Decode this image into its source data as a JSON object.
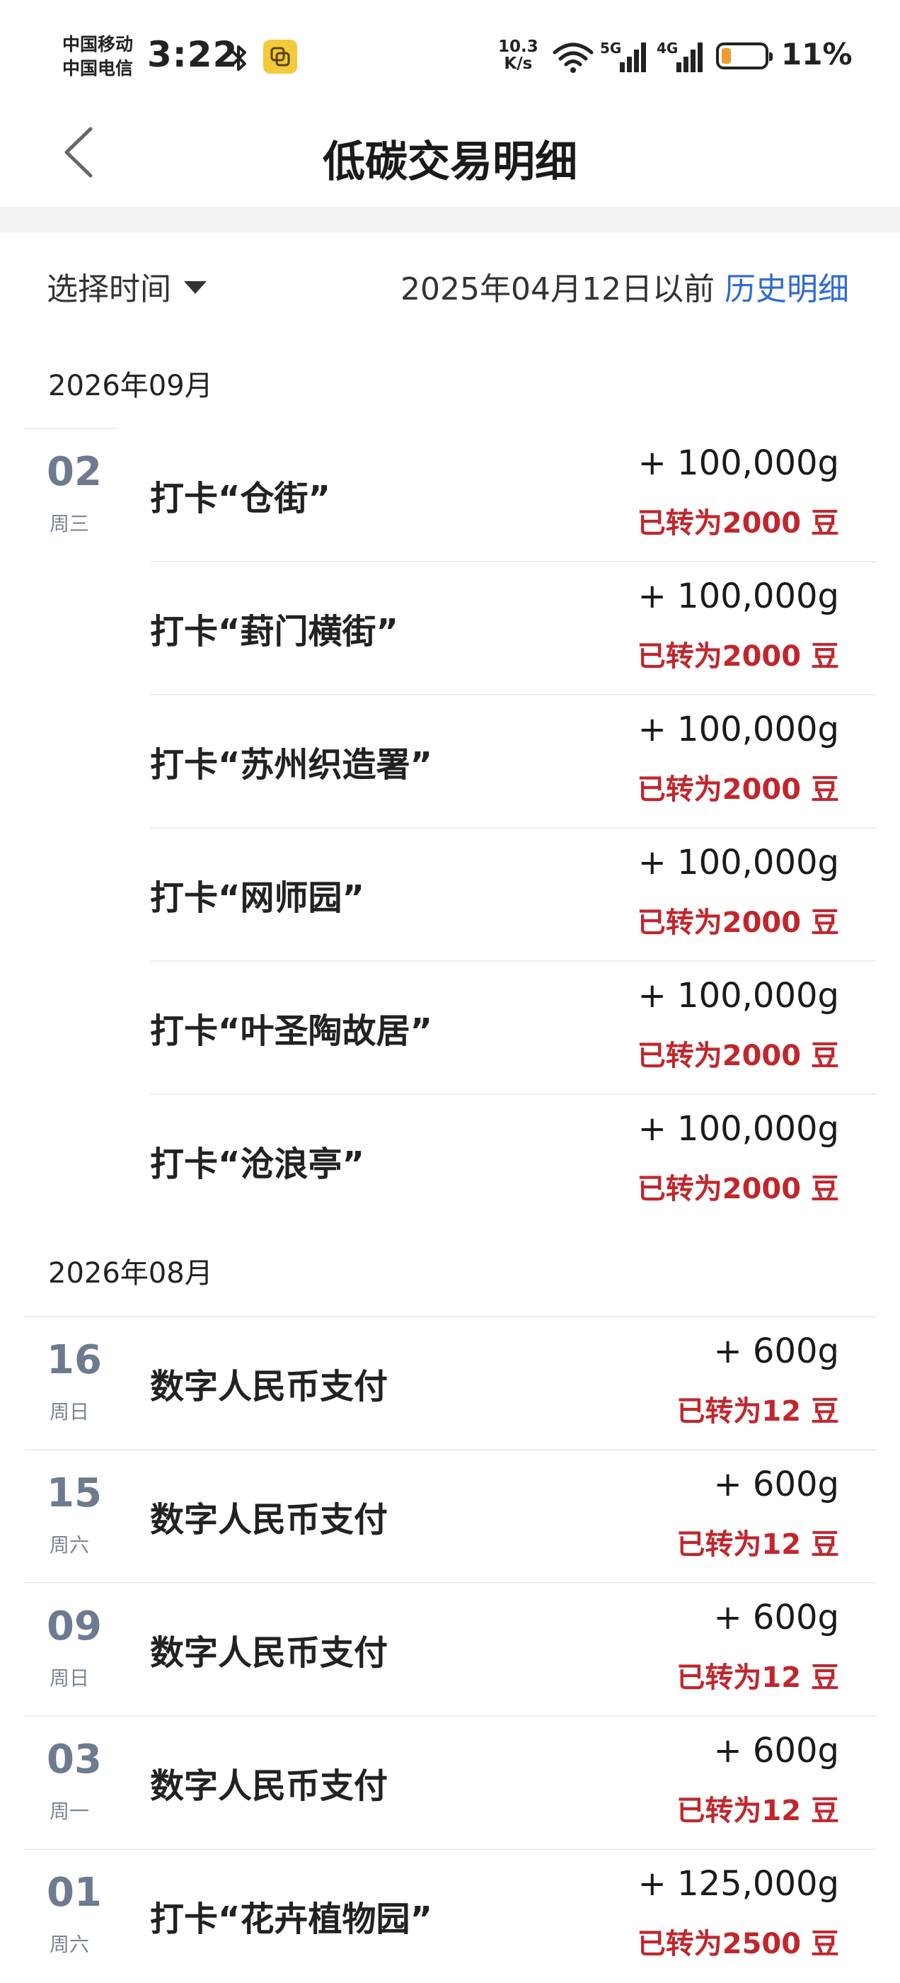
{
  "status_bar": {
    "carrier_1": "中国移动",
    "carrier_2": "中国电信",
    "time": "3:22",
    "net_speed_value": "10.3",
    "net_speed_unit": "K/s",
    "signal_1_label": "5G",
    "signal_2_label": "4G",
    "battery_level": 11,
    "battery_text": "11%",
    "accent": "#f09a2a"
  },
  "nav": {
    "back_icon": "chevron-left-icon",
    "title": "低碳交易明细"
  },
  "filter": {
    "select_label": "选择时间",
    "cutoff_text": "2025年04月12日以前",
    "history_link": "历史明细",
    "link_color": "#2f6bd4"
  },
  "sections": [
    {
      "month": "2026年09月",
      "rows": [
        {
          "day": "02",
          "weekday": "周三",
          "title": "打卡“仓街”",
          "amount": "+ 100,000g",
          "converted": "已转为2000 豆"
        },
        {
          "title": "打卡“葑门横街”",
          "amount": "+ 100,000g",
          "converted": "已转为2000 豆"
        },
        {
          "title": "打卡“苏州织造署”",
          "amount": "+ 100,000g",
          "converted": "已转为2000 豆"
        },
        {
          "title": "打卡“网师园”",
          "amount": "+ 100,000g",
          "converted": "已转为2000 豆"
        },
        {
          "title": "打卡“叶圣陶故居”",
          "amount": "+ 100,000g",
          "converted": "已转为2000 豆"
        },
        {
          "title": "打卡“沧浪亭”",
          "amount": "+ 100,000g",
          "converted": "已转为2000 豆"
        }
      ]
    },
    {
      "month": "2026年08月",
      "rows": [
        {
          "day": "16",
          "weekday": "周日",
          "title": "数字人民币支付",
          "amount": "+ 600g",
          "converted": "已转为12 豆"
        },
        {
          "day": "15",
          "weekday": "周六",
          "title": "数字人民币支付",
          "amount": "+ 600g",
          "converted": "已转为12 豆"
        },
        {
          "day": "09",
          "weekday": "周日",
          "title": "数字人民币支付",
          "amount": "+ 600g",
          "converted": "已转为12 豆"
        },
        {
          "day": "03",
          "weekday": "周一",
          "title": "数字人民币支付",
          "amount": "+ 600g",
          "converted": "已转为12 豆"
        },
        {
          "day": "01",
          "weekday": "周六",
          "title": "打卡“花卉植物园”",
          "amount": "+ 125,000g",
          "converted": "已转为2500 豆"
        }
      ]
    }
  ]
}
